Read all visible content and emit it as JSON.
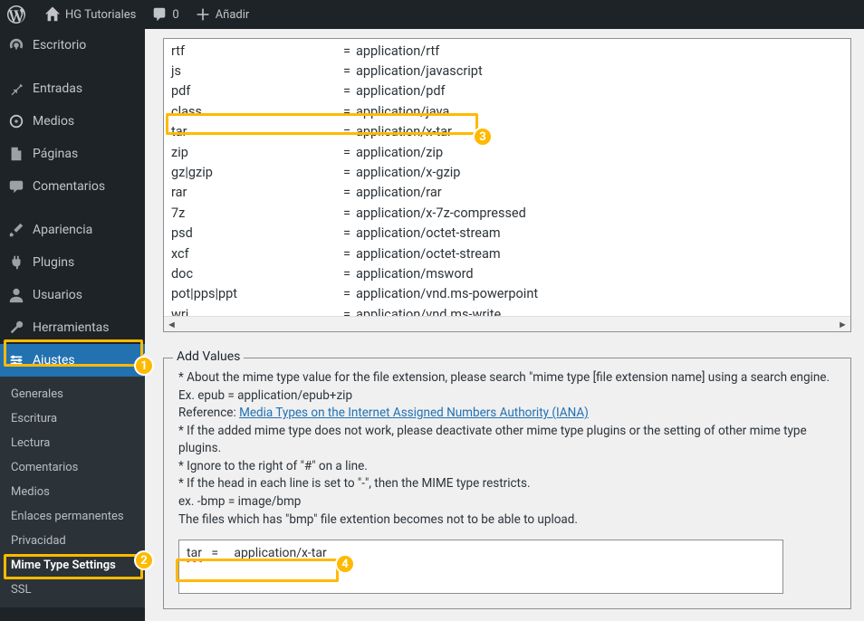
{
  "topbar": {
    "site_name": "HG Tutoriales",
    "comments_count": "0",
    "add_label": "Añadir"
  },
  "sidebar": {
    "escritorio": "Escritorio",
    "entradas": "Entradas",
    "medios": "Medios",
    "paginas": "Páginas",
    "comentarios": "Comentarios",
    "apariencia": "Apariencia",
    "plugins": "Plugins",
    "usuarios": "Usuarios",
    "herramientas": "Herramientas",
    "ajustes": "Ajustes",
    "submenu": {
      "generales": "Generales",
      "escritura": "Escritura",
      "lectura": "Lectura",
      "comentarios": "Comentarios",
      "medios": "Medios",
      "enlaces": "Enlaces permanentes",
      "privacidad": "Privacidad",
      "mime": "Mime Type Settings",
      "ssl": "SSL"
    }
  },
  "mime_rows": [
    {
      "ext": "rtf",
      "mime": "application/rtf"
    },
    {
      "ext": "js",
      "mime": "application/javascript"
    },
    {
      "ext": "pdf",
      "mime": "application/pdf"
    },
    {
      "ext": "class",
      "mime": "application/java"
    },
    {
      "ext": "tar",
      "mime": "application/x-tar"
    },
    {
      "ext": "zip",
      "mime": "application/zip"
    },
    {
      "ext": "gz|gzip",
      "mime": "application/x-gzip"
    },
    {
      "ext": "rar",
      "mime": "application/rar"
    },
    {
      "ext": "7z",
      "mime": "application/x-7z-compressed"
    },
    {
      "ext": "psd",
      "mime": "application/octet-stream"
    },
    {
      "ext": "xcf",
      "mime": "application/octet-stream"
    },
    {
      "ext": "doc",
      "mime": "application/msword"
    },
    {
      "ext": "pot|pps|ppt",
      "mime": "application/vnd.ms-powerpoint"
    },
    {
      "ext": "wri",
      "mime": "application/vnd.ms-write"
    }
  ],
  "addvalues": {
    "legend": "Add Values",
    "line1": "* About the mime type value for the file extension, please search \"mime type [file extension name] using a search engine.",
    "line2": "Ex. epub = application/epub+zip",
    "ref_label": "Reference: ",
    "ref_link": "Media Types on the Internet Assigned Numbers Authority (IANA)",
    "line3": "* If the added mime type does not work, please deactivate other mime type plugins or the setting of other mime type plugins.",
    "line4": "* Ignore to the right of \"#\" on a line.",
    "line5": "* If the head in each line is set to \"-\", then the MIME type restricts.",
    "line6": "ex. -bmp = image/bmp",
    "line7": "The files which has \"bmp\" file extention becomes not to be able to upload.",
    "input_value": "tar    =      application/x-tar"
  },
  "badges": {
    "b1": "1",
    "b2": "2",
    "b3": "3",
    "b4": "4"
  }
}
